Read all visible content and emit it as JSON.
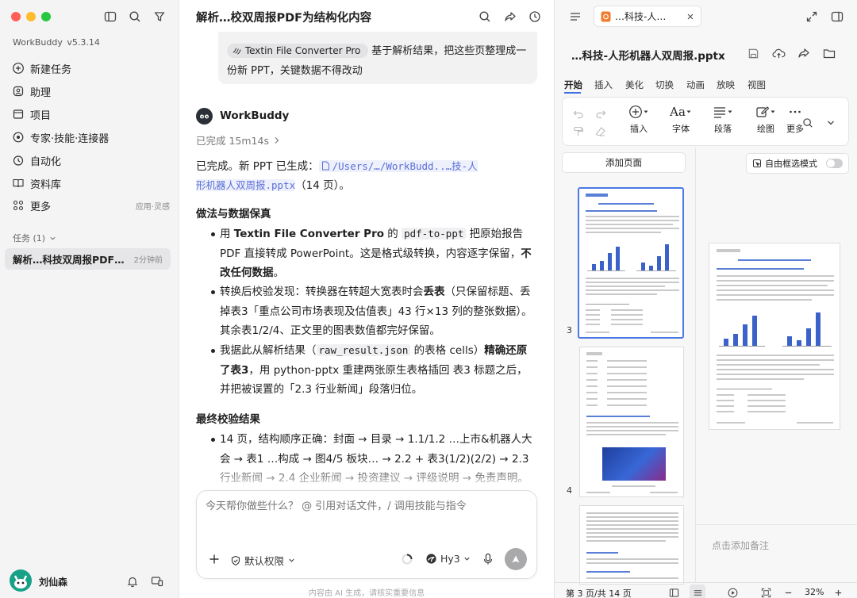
{
  "sidebar": {
    "app_name": "WorkBuddy",
    "version": "v5.3.14",
    "nav": [
      {
        "label": "新建任务",
        "icon": "plus-circle-icon"
      },
      {
        "label": "助理",
        "icon": "assistant-icon"
      },
      {
        "label": "项目",
        "icon": "project-icon"
      },
      {
        "label": "专家·技能·连接器",
        "icon": "expert-icon"
      },
      {
        "label": "自动化",
        "icon": "automation-icon"
      },
      {
        "label": "资料库",
        "icon": "library-icon"
      },
      {
        "label": "更多",
        "icon": "more-apps-icon",
        "hint": "应用·灵感"
      }
    ],
    "tasks_label": "任务 (1)",
    "task": {
      "title": "解析…科技双周报PDF…",
      "time": "2分钟前"
    },
    "user": {
      "name": "刘仙森"
    }
  },
  "chat": {
    "title": "解析…校双周报PDF为结构化内容",
    "user_msg": {
      "chip": "Textin File Converter Pro",
      "text": "基于解析结果，把这些页整理成一份新 PPT，关键数据不得改动"
    },
    "agent_name": "WorkBuddy",
    "status": "已完成 15m14s",
    "done_prefix": "已完成。新 PPT 已生成：",
    "file_link_1": "/Users/…/WorkBudd..…技-人",
    "file_link_2": "形机器人双周报.pptx",
    "page_count": "（14 页）。",
    "h1": "做法与数据保真",
    "b1": {
      "a": "用 ",
      "b": "Textin File Converter Pro",
      "c": " 的 ",
      "d": "pdf-to-ppt",
      "e": " 把原始报告 PDF 直接转成 PowerPoint。这是格式级转换，内容逐字保留，",
      "f": "不改任何数据",
      "g": "。"
    },
    "b2": {
      "a": "转换后校验发现：转换器在转超大宽表时会",
      "b": "丢表",
      "c": "（只保留标题、丢掉表3「重点公司市场表现及估值表」43 行×13 列的整张数据）。其余表1/2/4、正文里的图表数值都完好保留。"
    },
    "b3": {
      "a": "我据此从解析结果（",
      "b": "raw_result.json",
      "c": " 的表格 cells）",
      "d": "精确还原了表3",
      "e": "，用 python-pptx 重建两张原生表格插回 表3 标题之后，并把被误置的「2.3 行业新闻」段落归位。"
    },
    "h2": "最终校验结果",
    "b4": "14 页，结构顺序正确：封面 → 目录 → 1.1/1.2 …上市&机器人大会 → 表1 …构成 → 图4/5 板块… → 2.2 + 表3(1/2)(2/2) → 2.3 行业新闻 → 2.4 企业新闻 → 投资建议 → 评级说明 → 免责声明。",
    "input_placeholder": "今天帮你做些什么？ @ 引用对话文件，/ 调用技能与指令",
    "permission": "默认权限",
    "model": "Hy3",
    "disclaimer": "内容由 AI 生成，请核实重要信息"
  },
  "viewer": {
    "tab_title": "…科技-人…",
    "file_name": "…科技-人形机器人双周报.pptx",
    "menu": [
      "开始",
      "插入",
      "美化",
      "切换",
      "动画",
      "放映",
      "视图"
    ],
    "tools": [
      "插入",
      "字体",
      "段落",
      "绘图",
      "更多"
    ],
    "font_glyph": "Aa",
    "add_page": "添加页面",
    "free_select": "自由框选模式",
    "slide_numbers": [
      "3",
      "4"
    ],
    "add_note": "点击添加备注",
    "page_status": "第 3 页/共 14 页",
    "zoom": "32%",
    "colors": {
      "accent": "#3f6fe0",
      "slide_blue": "#3a62c9"
    }
  }
}
